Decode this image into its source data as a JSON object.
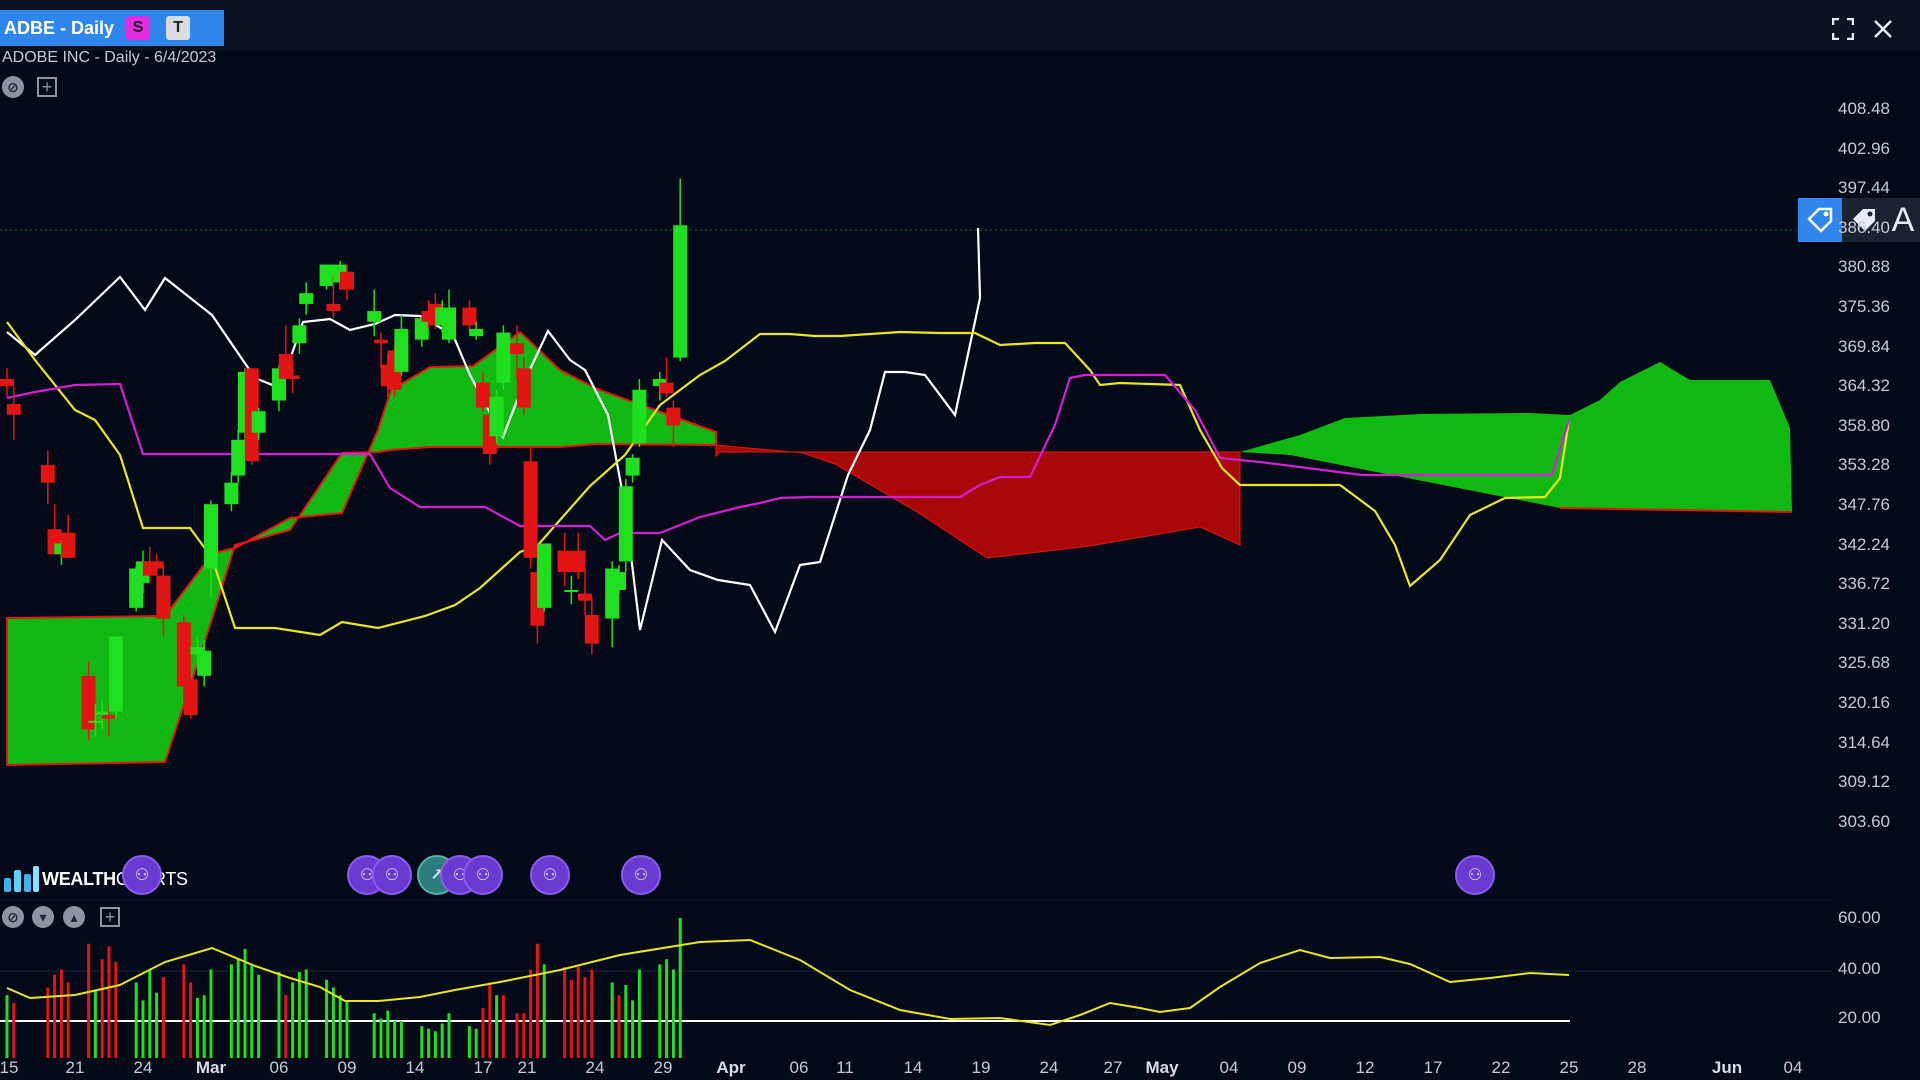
{
  "window": {
    "tab_title": "ADBE - Daily",
    "badge_s": "S",
    "badge_t": "T",
    "maximize_icon": "maximize-icon",
    "close_icon": "close-icon"
  },
  "chart_header": {
    "subtitle": "ADOBE INC - Daily - 6/4/2023"
  },
  "logo": {
    "text_part1": "WEALTH",
    "text_part2": "CHARTS"
  },
  "right_tools": {
    "letter": "A"
  },
  "price_axis": [
    "408.48",
    "402.96",
    "397.44",
    "386.40",
    "380.88",
    "375.36",
    "369.84",
    "364.32",
    "358.80",
    "353.28",
    "347.76",
    "342.24",
    "336.72",
    "331.20",
    "325.68",
    "320.16",
    "314.64",
    "309.12",
    "303.60"
  ],
  "volume_axis": [
    "60.00",
    "40.00",
    "20.00"
  ],
  "date_axis": [
    "15",
    "21",
    "24",
    "Mar",
    "06",
    "09",
    "14",
    "17",
    "21",
    "24",
    "29",
    "Apr",
    "06",
    "11",
    "14",
    "19",
    "24",
    "27",
    "May",
    "04",
    "09",
    "12",
    "17",
    "22",
    "25",
    "28",
    "Jun",
    "04"
  ],
  "colors": {
    "background": "#050a18",
    "up": "#1fe01f",
    "down": "#e31414",
    "cloud_bull": "#12b812",
    "cloud_bear": "#a80808",
    "tenkan": "#e8e81a",
    "kijun": "#d21fd2",
    "chikou": "#ffffff"
  },
  "chart_data": {
    "type": "candlestick",
    "title": "ADOBE INC - Daily - 6/4/2023",
    "ylim": [
      300.84,
      411.24
    ],
    "candles": [
      {
        "x": "02-15",
        "o": 371.0,
        "h": 372.5,
        "l": 368.5,
        "c": 370.0
      },
      {
        "x": "02-16",
        "o": 367.5,
        "h": 370.0,
        "l": 362.5,
        "c": 366.0
      },
      {
        "x": "02-21",
        "o": 359.0,
        "h": 361.0,
        "l": 353.5,
        "c": 356.5
      },
      {
        "x": "02-22",
        "o": 350.0,
        "h": 353.5,
        "l": 346.5,
        "c": 346.5
      },
      {
        "x": "02-23",
        "o": 346.5,
        "h": 348.5,
        "l": 345.0,
        "c": 348.0
      },
      {
        "x": "02-24",
        "o": 349.5,
        "h": 352.0,
        "l": 346.0,
        "c": 346.0
      },
      {
        "x": "02-27",
        "o": 329.5,
        "h": 331.5,
        "l": 320.5,
        "c": 322.0
      },
      {
        "x": "02-28",
        "o": 323.0,
        "h": 325.5,
        "l": 321.0,
        "c": 323.2
      },
      {
        "x": "03-01",
        "o": 324.0,
        "h": 326.0,
        "l": 322.0,
        "c": 324.5
      },
      {
        "x": "03-02",
        "o": 324.0,
        "h": 325.5,
        "l": 321.0,
        "c": 323.5
      },
      {
        "x": "03-03",
        "o": 324.5,
        "h": 335.0,
        "l": 323.5,
        "c": 335.0
      },
      {
        "x": "03-06",
        "o": 339.0,
        "h": 345.0,
        "l": 338.5,
        "c": 344.5
      },
      {
        "x": "03-07",
        "o": 342.5,
        "h": 347.0,
        "l": 341.0,
        "c": 345.5
      },
      {
        "x": "03-08",
        "o": 345.5,
        "h": 347.5,
        "l": 342.5,
        "c": 343.5
      },
      {
        "x": "03-09",
        "o": 345.5,
        "h": 346.5,
        "l": 343.5,
        "c": 344.5
      },
      {
        "x": "03-10",
        "o": 343.5,
        "h": 345.0,
        "l": 335.0,
        "c": 337.5
      },
      {
        "x": "03-13",
        "o": 337.0,
        "h": 338.0,
        "l": 326.0,
        "c": 328.0
      },
      {
        "x": "03-14",
        "o": 329.0,
        "h": 329.0,
        "l": 323.5,
        "c": 324.0
      },
      {
        "x": "03-15",
        "o": 332.5,
        "h": 335.0,
        "l": 330.5,
        "c": 333.5
      },
      {
        "x": "03-16",
        "o": 329.5,
        "h": 334.5,
        "l": 328.0,
        "c": 333.0
      },
      {
        "x": "03-17",
        "o": 344.5,
        "h": 354.0,
        "l": 340.5,
        "c": 353.5
      },
      {
        "x": "03-20",
        "o": 353.5,
        "h": 358.0,
        "l": 352.5,
        "c": 356.5
      },
      {
        "x": "03-21",
        "o": 357.5,
        "h": 364.0,
        "l": 356.5,
        "c": 362.5
      },
      {
        "x": "03-22",
        "o": 363.5,
        "h": 372.5,
        "l": 361.5,
        "c": 372.0
      },
      {
        "x": "03-23",
        "o": 372.5,
        "h": 372.5,
        "l": 359.0,
        "c": 359.5
      },
      {
        "x": "03-24",
        "o": 363.5,
        "h": 367.0,
        "l": 362.5,
        "c": 366.5
      },
      {
        "x": "03-27",
        "o": 368.0,
        "h": 373.0,
        "l": 366.5,
        "c": 372.5
      },
      {
        "x": "03-28",
        "o": 374.5,
        "h": 378.5,
        "l": 373.5,
        "c": 371.0
      },
      {
        "x": "03-29",
        "o": 371.5,
        "h": 373.5,
        "l": 369.0,
        "c": 371.0
      },
      {
        "x": "03-30",
        "o": 376.0,
        "h": 379.5,
        "l": 374.5,
        "c": 378.5
      },
      {
        "x": "03-31",
        "o": 381.5,
        "h": 384.5,
        "l": 380.0,
        "c": 383.0
      },
      {
        "x": "04-03",
        "o": 384.0,
        "h": 387.0,
        "l": 383.5,
        "c": 387.0
      },
      {
        "x": "04-04",
        "o": 381.5,
        "h": 385.5,
        "l": 379.5,
        "c": 380.5
      },
      {
        "x": "04-05",
        "o": 384.5,
        "h": 387.5,
        "l": 383.5,
        "c": 387.0
      },
      {
        "x": "04-06",
        "o": 386.0,
        "h": 387.0,
        "l": 382.0,
        "c": 383.5
      },
      {
        "x": "04-10",
        "o": 379.0,
        "h": 383.5,
        "l": 377.0,
        "c": 380.5
      },
      {
        "x": "04-11",
        "o": 376.5,
        "h": 377.5,
        "l": 372.5,
        "c": 376.0
      },
      {
        "x": "04-12",
        "o": 373.0,
        "h": 374.5,
        "l": 368.5,
        "c": 370.0
      },
      {
        "x": "04-13",
        "o": 375.0,
        "h": 376.0,
        "l": 368.5,
        "c": 369.5
      },
      {
        "x": "04-14",
        "o": 372.0,
        "h": 380.0,
        "l": 371.5,
        "c": 378.0
      },
      {
        "x": "04-17",
        "o": 376.5,
        "h": 380.0,
        "l": 375.5,
        "c": 379.5
      },
      {
        "x": "04-18",
        "o": 380.5,
        "h": 382.0,
        "l": 378.0,
        "c": 379.0
      },
      {
        "x": "04-19",
        "o": 381.5,
        "h": 383.0,
        "l": 378.0,
        "c": 378.5
      },
      {
        "x": "04-20",
        "o": 378.5,
        "h": 382.0,
        "l": 377.5,
        "c": 381.0
      },
      {
        "x": "04-21",
        "o": 376.5,
        "h": 383.5,
        "l": 376.0,
        "c": 381.0
      },
      {
        "x": "04-24",
        "o": 381.0,
        "h": 382.0,
        "l": 377.5,
        "c": 378.5
      },
      {
        "x": "04-25",
        "o": 377.0,
        "h": 379.0,
        "l": 376.5,
        "c": 378.0
      },
      {
        "x": "04-26",
        "o": 370.5,
        "h": 372.0,
        "l": 366.5,
        "c": 367.0
      },
      {
        "x": "04-27",
        "o": 366.0,
        "h": 369.0,
        "l": 359.0,
        "c": 360.5
      },
      {
        "x": "04-28",
        "o": 363.0,
        "h": 369.5,
        "l": 362.0,
        "c": 368.5
      },
      {
        "x": "04-29",
        "o": 370.5,
        "h": 378.5,
        "l": 369.5,
        "c": 377.5
      },
      {
        "x": "05-01",
        "o": 376.0,
        "h": 378.5,
        "l": 371.0,
        "c": 374.5
      },
      {
        "x": "05-02",
        "o": 372.5,
        "h": 374.0,
        "l": 366.0,
        "c": 367.0
      },
      {
        "x": "05-03",
        "o": 359.5,
        "h": 361.5,
        "l": 344.5,
        "c": 346.0
      },
      {
        "x": "05-04",
        "o": 344.0,
        "h": 346.0,
        "l": 334.0,
        "c": 336.5
      },
      {
        "x": "05-05",
        "o": 339.0,
        "h": 348.0,
        "l": 338.5,
        "c": 348.0
      },
      {
        "x": "05-08",
        "o": 347.0,
        "h": 349.5,
        "l": 342.0,
        "c": 344.0
      },
      {
        "x": "05-09",
        "o": 341.5,
        "h": 343.5,
        "l": 339.5,
        "c": 341.5
      },
      {
        "x": "05-10",
        "o": 347.0,
        "h": 349.5,
        "l": 343.0,
        "c": 344.0
      },
      {
        "x": "05-11",
        "o": 341.0,
        "h": 344.5,
        "l": 338.0,
        "c": 340.0
      },
      {
        "x": "05-12",
        "o": 338.0,
        "h": 340.5,
        "l": 332.5,
        "c": 334.0
      },
      {
        "x": "05-15",
        "o": 337.5,
        "h": 345.5,
        "l": 333.5,
        "c": 344.5
      },
      {
        "x": "05-16",
        "o": 341.5,
        "h": 345.0,
        "l": 341.0,
        "c": 344.0
      },
      {
        "x": "05-17",
        "o": 345.5,
        "h": 357.0,
        "l": 344.0,
        "c": 356.0
      },
      {
        "x": "05-18",
        "o": 357.5,
        "h": 360.5,
        "l": 356.5,
        "c": 360.0
      },
      {
        "x": "05-19",
        "o": 362.0,
        "h": 371.0,
        "l": 361.5,
        "c": 369.5
      },
      {
        "x": "05-22",
        "o": 370.0,
        "h": 372.0,
        "l": 368.0,
        "c": 371.0
      },
      {
        "x": "05-23",
        "o": 370.5,
        "h": 374.0,
        "l": 368.5,
        "c": 369.0
      },
      {
        "x": "05-24",
        "o": 367.0,
        "h": 368.0,
        "l": 361.5,
        "c": 364.5
      },
      {
        "x": "05-25",
        "o": 374.0,
        "h": 399.0,
        "l": 373.5,
        "c": 392.5
      }
    ],
    "volume": [
      {
        "x": "02-15",
        "v": 30,
        "dir": "up"
      },
      {
        "x": "02-16",
        "v": 27,
        "dir": "down"
      },
      {
        "x": "02-21",
        "v": 33,
        "dir": "down"
      },
      {
        "x": "02-22",
        "v": 38,
        "dir": "down"
      },
      {
        "x": "02-23",
        "v": 40,
        "dir": "down"
      },
      {
        "x": "02-24",
        "v": 35,
        "dir": "down"
      },
      {
        "x": "02-27",
        "v": 50,
        "dir": "down"
      },
      {
        "x": "02-28",
        "v": 32,
        "dir": "up"
      },
      {
        "x": "03-01",
        "v": 44,
        "dir": "down"
      },
      {
        "x": "03-02",
        "v": 49,
        "dir": "down"
      },
      {
        "x": "03-03",
        "v": 43,
        "dir": "down"
      },
      {
        "x": "03-06",
        "v": 35,
        "dir": "up"
      },
      {
        "x": "03-07",
        "v": 28,
        "dir": "up"
      },
      {
        "x": "03-08",
        "v": 40,
        "dir": "up"
      },
      {
        "x": "03-09",
        "v": 31,
        "dir": "up"
      },
      {
        "x": "03-10",
        "v": 37,
        "dir": "down"
      },
      {
        "x": "03-13",
        "v": 42,
        "dir": "down"
      },
      {
        "x": "03-14",
        "v": 35,
        "dir": "down"
      },
      {
        "x": "03-15",
        "v": 29,
        "dir": "up"
      },
      {
        "x": "03-16",
        "v": 30,
        "dir": "up"
      },
      {
        "x": "03-17",
        "v": 40,
        "dir": "up"
      },
      {
        "x": "03-20",
        "v": 42,
        "dir": "up"
      },
      {
        "x": "03-21",
        "v": 44,
        "dir": "up"
      },
      {
        "x": "03-22",
        "v": 48,
        "dir": "up"
      },
      {
        "x": "03-23",
        "v": 42,
        "dir": "up"
      },
      {
        "x": "03-24",
        "v": 38,
        "dir": "up"
      },
      {
        "x": "03-27",
        "v": 39,
        "dir": "up"
      },
      {
        "x": "03-28",
        "v": 30,
        "dir": "down"
      },
      {
        "x": "03-29",
        "v": 35,
        "dir": "up"
      },
      {
        "x": "03-30",
        "v": 39,
        "dir": "up"
      },
      {
        "x": "03-31",
        "v": 40,
        "dir": "up"
      },
      {
        "x": "04-03",
        "v": 36,
        "dir": "up"
      },
      {
        "x": "04-04",
        "v": 33,
        "dir": "up"
      },
      {
        "x": "04-05",
        "v": 30,
        "dir": "up"
      },
      {
        "x": "04-06",
        "v": 28,
        "dir": "up"
      },
      {
        "x": "04-10",
        "v": 23,
        "dir": "up"
      },
      {
        "x": "04-11",
        "v": 21,
        "dir": "up"
      },
      {
        "x": "04-12",
        "v": 24,
        "dir": "up"
      },
      {
        "x": "04-13",
        "v": 20,
        "dir": "up"
      },
      {
        "x": "04-14",
        "v": 20,
        "dir": "up"
      },
      {
        "x": "04-17",
        "v": 18,
        "dir": "up"
      },
      {
        "x": "04-18",
        "v": 17,
        "dir": "up"
      },
      {
        "x": "04-19",
        "v": 16,
        "dir": "up"
      },
      {
        "x": "04-20",
        "v": 19,
        "dir": "up"
      },
      {
        "x": "04-21",
        "v": 23,
        "dir": "up"
      },
      {
        "x": "04-24",
        "v": 18,
        "dir": "up"
      },
      {
        "x": "04-25",
        "v": 17,
        "dir": "up"
      },
      {
        "x": "04-26",
        "v": 25,
        "dir": "down"
      },
      {
        "x": "04-27",
        "v": 35,
        "dir": "down"
      },
      {
        "x": "04-28",
        "v": 30,
        "dir": "up"
      },
      {
        "x": "04-29",
        "v": 30,
        "dir": "down"
      },
      {
        "x": "05-01",
        "v": 23,
        "dir": "down"
      },
      {
        "x": "05-02",
        "v": 23,
        "dir": "down"
      },
      {
        "x": "05-03",
        "v": 40,
        "dir": "down"
      },
      {
        "x": "05-04",
        "v": 50,
        "dir": "down"
      },
      {
        "x": "05-05",
        "v": 42,
        "dir": "up"
      },
      {
        "x": "05-08",
        "v": 41,
        "dir": "down"
      },
      {
        "x": "05-09",
        "v": 36,
        "dir": "down"
      },
      {
        "x": "05-10",
        "v": 41,
        "dir": "down"
      },
      {
        "x": "05-11",
        "v": 37,
        "dir": "down"
      },
      {
        "x": "05-12",
        "v": 40,
        "dir": "down"
      },
      {
        "x": "05-15",
        "v": 35,
        "dir": "up"
      },
      {
        "x": "05-16",
        "v": 30,
        "dir": "down"
      },
      {
        "x": "05-17",
        "v": 34,
        "dir": "up"
      },
      {
        "x": "05-18",
        "v": 28,
        "dir": "up"
      },
      {
        "x": "05-19",
        "v": 40,
        "dir": "up"
      },
      {
        "x": "05-22",
        "v": 42,
        "dir": "up"
      },
      {
        "x": "05-23",
        "v": 44,
        "dir": "up"
      },
      {
        "x": "05-24",
        "v": 40,
        "dir": "up"
      },
      {
        "x": "05-25",
        "v": 60,
        "dir": "up"
      }
    ]
  }
}
